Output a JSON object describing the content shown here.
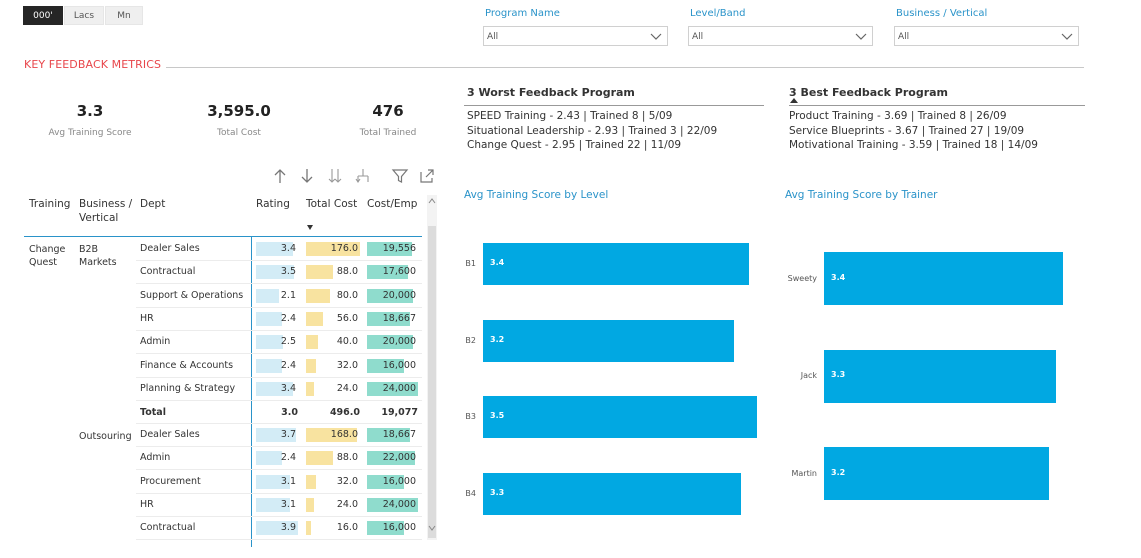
{
  "units": {
    "options": [
      "000'",
      "Lacs",
      "Mn"
    ],
    "selected": "000'"
  },
  "slicers": [
    {
      "label": "Program Name",
      "value": "All"
    },
    {
      "label": "Level/Band",
      "value": "All"
    },
    {
      "label": "Business / Vertical",
      "value": "All"
    }
  ],
  "section_title_a": "KEY ",
  "section_title_b": "FEEDBACK",
  "section_title_c": " METRICS",
  "kpis": [
    {
      "value": "3.3",
      "label": "Avg Training Score"
    },
    {
      "value": "3,595.0",
      "label": "Total Cost"
    },
    {
      "value": "476",
      "label": "Total Trained"
    }
  ],
  "worst": {
    "title": "3 Worst Feedback Program",
    "items": [
      "SPEED Training - 2.43 | Trained 8 | 5/09",
      "Situational Leadership - 2.93 | Trained 3 | 22/09",
      "Change Quest - 2.95 | Trained 22 | 11/09"
    ]
  },
  "best": {
    "title": "3 Best Feedback Program",
    "items": [
      "Product Training - 3.69 | Trained 8 | 26/09",
      "Service Blueprints - 3.67 | Trained 27 | 19/09",
      "Motivational Training - 3.59 | Trained 18 | 14/09"
    ]
  },
  "toolbar_icons": [
    "arrow-up-icon",
    "arrow-down-icon",
    "double-arrow-down-icon",
    "expand-hierarchy-icon",
    "filter-icon",
    "focus-mode-icon"
  ],
  "matrix": {
    "headers": {
      "training": "Training",
      "business_l1": "Business /",
      "business_l2": "Vertical",
      "dept": "Dept",
      "rating": "Rating",
      "total_cost": "Total Cost",
      "cost_emp": "Cost/Emp"
    },
    "training_l1": "Change",
    "training_l2": "Quest",
    "group1": {
      "business_l1": "B2B",
      "business_l2": "Markets",
      "rows": [
        {
          "dept": "Dealer Sales",
          "rating": "3.4",
          "rating_frac": 0.87,
          "cost": "176.0",
          "cost_frac": 1.0,
          "emp": "19,556",
          "emp_frac": 0.89
        },
        {
          "dept": "Contractual",
          "rating": "3.5",
          "rating_frac": 0.9,
          "cost": "88.0",
          "cost_frac": 0.5,
          "emp": "17,600",
          "emp_frac": 0.8
        },
        {
          "dept": "Support & Operations",
          "rating": "2.1",
          "rating_frac": 0.54,
          "cost": "80.0",
          "cost_frac": 0.45,
          "emp": "20,000",
          "emp_frac": 0.91
        },
        {
          "dept": "HR",
          "rating": "2.4",
          "rating_frac": 0.62,
          "cost": "56.0",
          "cost_frac": 0.32,
          "emp": "18,667",
          "emp_frac": 0.85
        },
        {
          "dept": "Admin",
          "rating": "2.5",
          "rating_frac": 0.64,
          "cost": "40.0",
          "cost_frac": 0.23,
          "emp": "20,000",
          "emp_frac": 0.91
        },
        {
          "dept": "Finance & Accounts",
          "rating": "2.4",
          "rating_frac": 0.62,
          "cost": "32.0",
          "cost_frac": 0.18,
          "emp": "16,000",
          "emp_frac": 0.73
        },
        {
          "dept": "Planning & Strategy",
          "rating": "3.4",
          "rating_frac": 0.87,
          "cost": "24.0",
          "cost_frac": 0.14,
          "emp": "24,000",
          "emp_frac": 1.0
        }
      ],
      "total": {
        "label": "Total",
        "rating": "3.0",
        "cost": "496.0",
        "emp": "19,077"
      }
    },
    "group2": {
      "business_l1": "Outsouring",
      "rows": [
        {
          "dept": "Dealer Sales",
          "rating": "3.7",
          "rating_frac": 0.95,
          "cost": "168.0",
          "cost_frac": 0.95,
          "emp": "18,667",
          "emp_frac": 0.85
        },
        {
          "dept": "Admin",
          "rating": "2.4",
          "rating_frac": 0.62,
          "cost": "88.0",
          "cost_frac": 0.5,
          "emp": "22,000",
          "emp_frac": 0.95
        },
        {
          "dept": "Procurement",
          "rating": "3.1",
          "rating_frac": 0.8,
          "cost": "32.0",
          "cost_frac": 0.18,
          "emp": "16,000",
          "emp_frac": 0.73
        },
        {
          "dept": "HR",
          "rating": "3.1",
          "rating_frac": 0.8,
          "cost": "24.0",
          "cost_frac": 0.14,
          "emp": "24,000",
          "emp_frac": 1.0
        },
        {
          "dept": "Contractual",
          "rating": "3.9",
          "rating_frac": 1.0,
          "cost": "16.0",
          "cost_frac": 0.09,
          "emp": "16,000",
          "emp_frac": 0.73
        }
      ]
    }
  },
  "chart_data": [
    {
      "type": "bar",
      "orientation": "horizontal",
      "title": "Avg Training Score by Level",
      "categories": [
        "B1",
        "B2",
        "B3",
        "B4"
      ],
      "values": [
        3.4,
        3.2,
        3.5,
        3.3
      ],
      "labels": [
        "3.4",
        "3.2",
        "3.5",
        "3.3"
      ],
      "color": "#01a8e2",
      "xlim": [
        0,
        3.5
      ],
      "grid": false
    },
    {
      "type": "bar",
      "orientation": "horizontal",
      "title": "Avg Training Score by Trainer",
      "categories": [
        "Sweety",
        "Jack",
        "Martin"
      ],
      "values": [
        3.4,
        3.3,
        3.2
      ],
      "labels": [
        "3.4",
        "3.3",
        "3.2"
      ],
      "color": "#01a8e2",
      "xlim": [
        0,
        3.5
      ],
      "grid": false
    }
  ]
}
